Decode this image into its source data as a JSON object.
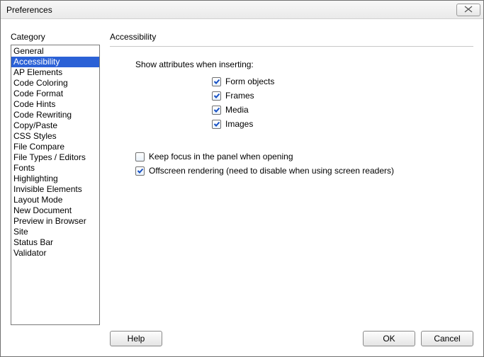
{
  "window": {
    "title": "Preferences"
  },
  "category": {
    "label": "Category",
    "selected_index": 1,
    "items": [
      "General",
      "Accessibility",
      "AP Elements",
      "Code Coloring",
      "Code Format",
      "Code Hints",
      "Code Rewriting",
      "Copy/Paste",
      "CSS Styles",
      "File Compare",
      "File Types / Editors",
      "Fonts",
      "Highlighting",
      "Invisible Elements",
      "Layout Mode",
      "New Document",
      "Preview in Browser",
      "Site",
      "Status Bar",
      "Validator"
    ]
  },
  "panel": {
    "title": "Accessibility",
    "section1_heading": "Show attributes when inserting:",
    "checks_insert": [
      {
        "label": "Form objects",
        "checked": true
      },
      {
        "label": "Frames",
        "checked": true
      },
      {
        "label": "Media",
        "checked": true
      },
      {
        "label": "Images",
        "checked": true
      }
    ],
    "check_keep_focus": {
      "label": "Keep focus in the panel when opening",
      "checked": false
    },
    "check_offscreen": {
      "label": "Offscreen rendering (need to disable when using screen readers)",
      "checked": true
    }
  },
  "buttons": {
    "help": "Help",
    "ok": "OK",
    "cancel": "Cancel"
  }
}
